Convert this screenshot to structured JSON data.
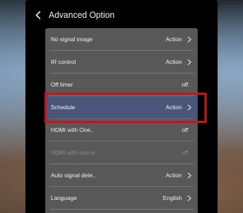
{
  "header": {
    "title": "Advanced Option",
    "back_icon": "chevron-left-icon"
  },
  "rows": [
    {
      "id": "no-signal-image",
      "label": "No signal image",
      "value": "Action",
      "chevron": true,
      "selected": false,
      "disabled": false
    },
    {
      "id": "ir-control",
      "label": "IR control",
      "value": "Action",
      "chevron": true,
      "selected": false,
      "disabled": false
    },
    {
      "id": "off-timer",
      "label": "Off timer",
      "value": "off",
      "chevron": false,
      "selected": false,
      "disabled": false
    },
    {
      "id": "schedule",
      "label": "Schedule",
      "value": "Action",
      "chevron": true,
      "selected": true,
      "disabled": false
    },
    {
      "id": "hdmi-with-one",
      "label": "HDMI with One..",
      "value": "off",
      "chevron": false,
      "selected": false,
      "disabled": false
    },
    {
      "id": "hdmi-with-one-w",
      "label": "HDMI with one w..",
      "value": "off",
      "chevron": false,
      "selected": false,
      "disabled": true
    },
    {
      "id": "auto-signal-detect",
      "label": "Auto signal dete..",
      "value": "Action",
      "chevron": true,
      "selected": false,
      "disabled": false
    },
    {
      "id": "language",
      "label": "Language",
      "value": "English",
      "chevron": true,
      "selected": false,
      "disabled": false
    }
  ],
  "colors": {
    "panel_bg": "#000000",
    "list_bg": "#585858",
    "selected_row": "#4a5679",
    "highlight_border": "#d50f0f",
    "text": "#f0f0f0",
    "disabled_text": "#8e8e8e"
  }
}
